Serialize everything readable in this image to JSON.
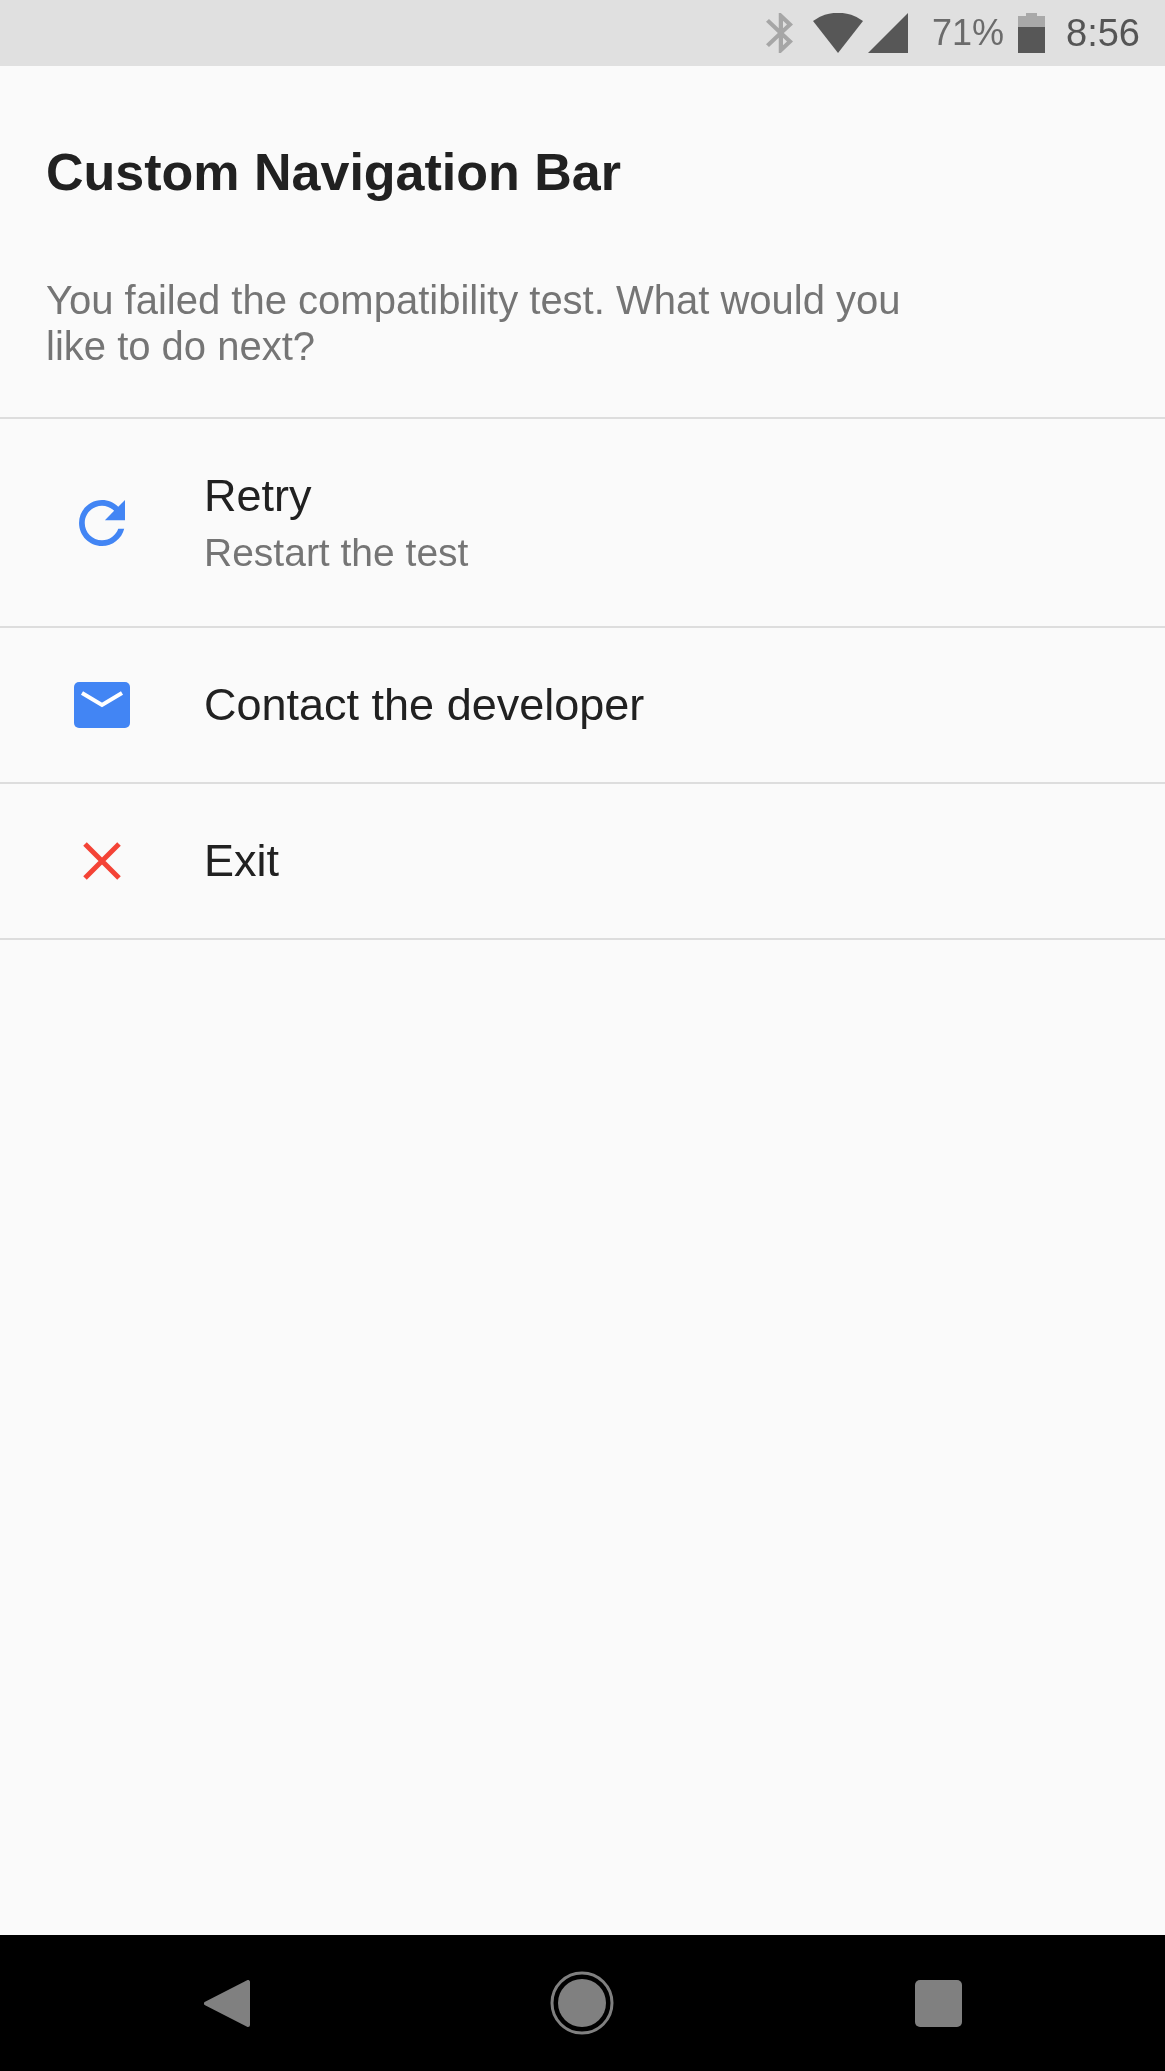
{
  "status_bar": {
    "battery": "71%",
    "time": "8:56"
  },
  "dialog": {
    "title": "Custom Navigation Bar",
    "message": "You failed the compatibility test. What would you like to do next?"
  },
  "options": [
    {
      "kind": "retry",
      "label": "Retry",
      "description": "Restart the test"
    },
    {
      "kind": "contact",
      "label": "Contact the developer"
    },
    {
      "kind": "exit",
      "label": "Exit"
    }
  ]
}
